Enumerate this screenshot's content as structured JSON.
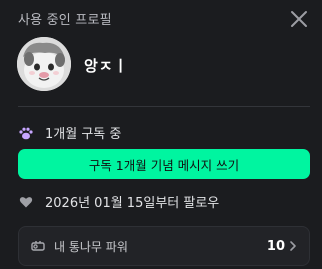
{
  "header": {
    "title": "사용 중인 프로필"
  },
  "profile": {
    "nickname": "앙ㅈㅣ"
  },
  "subscription": {
    "status_text": "1개월 구독 중",
    "cta_label": "구독 1개월 기념 메시지 쓰기"
  },
  "follow": {
    "since_text": "2026년 01월 15일부터 팔로우"
  },
  "power": {
    "label": "내 통나무 파워",
    "value": "10"
  },
  "colors": {
    "accent": "#00f5a0",
    "background": "#1b1c1f"
  },
  "icons": {
    "close": "close-icon",
    "subscription": "paw-icon",
    "follow": "heart-icon",
    "power": "log-icon",
    "chevron": "chevron-right-icon"
  }
}
